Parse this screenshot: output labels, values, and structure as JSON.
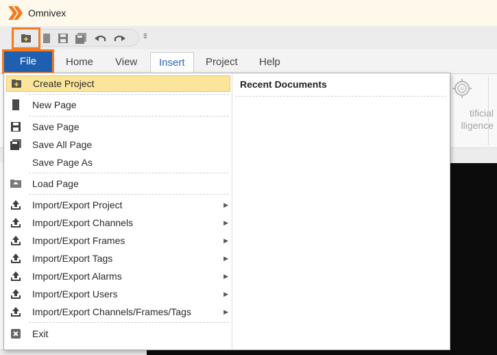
{
  "app": {
    "title": "Omnivex",
    "accent": "#f47a1f",
    "file_blue": "#1f5fb0"
  },
  "quick_access": {
    "buttons": [
      "create-project-icon",
      "page-icon",
      "save-icon",
      "save-all-icon",
      "undo-icon",
      "redo-icon"
    ],
    "customize_glyph": "⩱"
  },
  "tabs": {
    "file": "File",
    "home": "Home",
    "view": "View",
    "insert": "Insert",
    "project": "Project",
    "help": "Help"
  },
  "ribbon": {
    "ai_label_line1": "tificial",
    "ai_label_line2": "lligence",
    "ai_badge": "AI"
  },
  "file_menu": {
    "items": [
      {
        "label": "Create Project",
        "icon": "create-project-icon",
        "highlight": true
      },
      {
        "label": "New Page",
        "icon": "new-page-icon"
      },
      {
        "label": "Save Page",
        "icon": "save-icon"
      },
      {
        "label": "Save All Page",
        "icon": "save-all-icon"
      },
      {
        "label": "Save Page As",
        "icon": ""
      },
      {
        "label": "Load Page",
        "icon": "load-page-icon"
      },
      {
        "label": "Import/Export Project",
        "icon": "import-export-icon",
        "submenu": true
      },
      {
        "label": "Import/Export Channels",
        "icon": "import-export-icon",
        "submenu": true
      },
      {
        "label": "Import/Export Frames",
        "icon": "import-export-icon",
        "submenu": true
      },
      {
        "label": "Import/Export Tags",
        "icon": "import-export-icon",
        "submenu": true
      },
      {
        "label": "Import/Export Alarms",
        "icon": "import-export-icon",
        "submenu": true
      },
      {
        "label": "Import/Export Users",
        "icon": "import-export-icon",
        "submenu": true
      },
      {
        "label": "Import/Export Channels/Frames/Tags",
        "icon": "import-export-icon",
        "submenu": true
      },
      {
        "label": "Exit",
        "icon": "exit-icon"
      }
    ],
    "submenu_arrow": "▶",
    "recent_title": "Recent Documents"
  }
}
